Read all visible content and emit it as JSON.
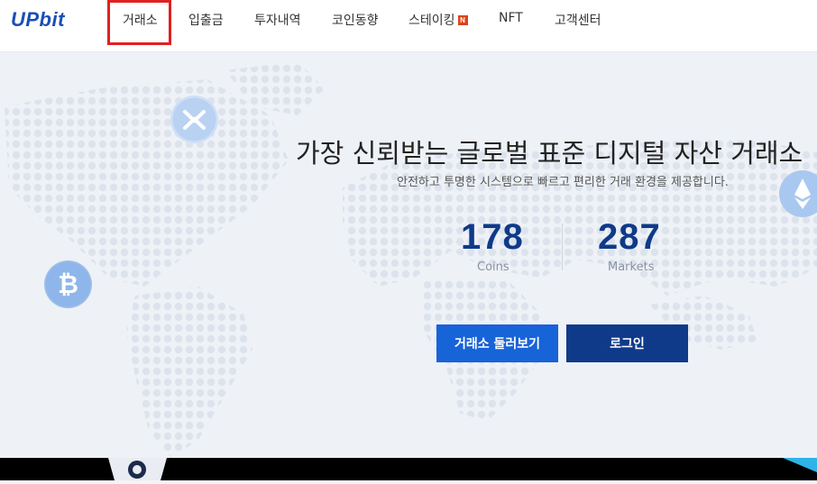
{
  "brand": {
    "logo": "UPbit",
    "color": "#1a4fb7"
  },
  "nav": {
    "items": [
      {
        "label": "거래소",
        "selected": true
      },
      {
        "label": "입출금"
      },
      {
        "label": "투자내역"
      },
      {
        "label": "코인동향"
      },
      {
        "label": "스테이킹",
        "badge": "N"
      },
      {
        "label": "NFT"
      },
      {
        "label": "고객센터"
      }
    ]
  },
  "hero": {
    "title": "가장 신뢰받는 글로벌 표준 디지털 자산 거래소",
    "subtitle": "안전하고 투명한 시스템으로 빠르고 편리한 거래 환경을 제공합니다.",
    "stats": [
      {
        "value": "178",
        "label": "Coins"
      },
      {
        "value": "287",
        "label": "Markets"
      }
    ],
    "buttons": {
      "explore": "거래소 둘러보기",
      "login": "로그인"
    },
    "icons": [
      "xrp-coin-icon",
      "bitcoin-coin-icon",
      "ethereum-coin-icon"
    ]
  },
  "colors": {
    "accent": "#1763d8",
    "navy": "#0f3a8a",
    "highlight": "#e02020"
  }
}
